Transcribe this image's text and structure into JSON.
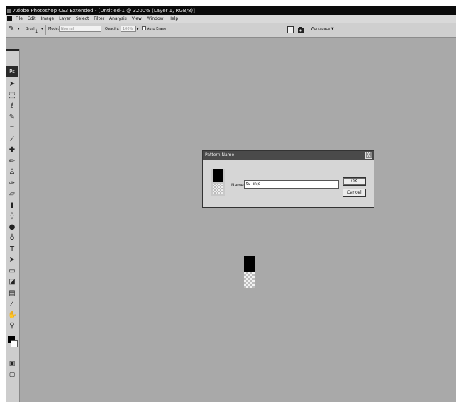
{
  "window": {
    "title": "Adobe Photoshop CS3 Extended - [Untitled-1 @ 3200% (Layer 1, RGB/8)]"
  },
  "menubar": {
    "items": [
      "File",
      "Edit",
      "Image",
      "Layer",
      "Select",
      "Filter",
      "Analysis",
      "View",
      "Window",
      "Help"
    ]
  },
  "options": {
    "brush_label": "Brush:",
    "brush_size": "1",
    "mode_label": "Mode:",
    "mode_value": "Normal",
    "opacity_label": "Opacity:",
    "opacity_value": "100%",
    "auto_erase_label": "Auto Erase",
    "workspace_label": "Workspace ▼"
  },
  "toolbox": {
    "logo": "Ps",
    "tools": [
      {
        "name": "move-tool-icon",
        "glyph": "➤"
      },
      {
        "name": "marquee-tool-icon",
        "glyph": "⬚"
      },
      {
        "name": "lasso-tool-icon",
        "glyph": "ℓ"
      },
      {
        "name": "quick-select-tool-icon",
        "glyph": "✎"
      },
      {
        "name": "crop-tool-icon",
        "glyph": "⌗"
      },
      {
        "name": "slice-tool-icon",
        "glyph": "⁄"
      },
      {
        "name": "healing-brush-tool-icon",
        "glyph": "✚"
      },
      {
        "name": "brush-tool-icon",
        "glyph": "✏"
      },
      {
        "name": "clone-stamp-tool-icon",
        "glyph": "♙"
      },
      {
        "name": "history-brush-tool-icon",
        "glyph": "✑"
      },
      {
        "name": "eraser-tool-icon",
        "glyph": "▱"
      },
      {
        "name": "gradient-tool-icon",
        "glyph": "▮"
      },
      {
        "name": "blur-tool-icon",
        "glyph": "◊"
      },
      {
        "name": "dodge-tool-icon",
        "glyph": "●"
      },
      {
        "name": "pen-tool-icon",
        "glyph": "♁"
      },
      {
        "name": "type-tool-icon",
        "glyph": "T"
      },
      {
        "name": "path-select-tool-icon",
        "glyph": "➤"
      },
      {
        "name": "shape-tool-icon",
        "glyph": "▭"
      },
      {
        "name": "3d-tool-icon",
        "glyph": "◪"
      },
      {
        "name": "notes-tool-icon",
        "glyph": "▤"
      },
      {
        "name": "eyedropper-tool-icon",
        "glyph": "⁄"
      },
      {
        "name": "hand-tool-icon",
        "glyph": "✋"
      },
      {
        "name": "zoom-tool-icon",
        "glyph": "⚲"
      }
    ]
  },
  "dialog": {
    "title": "Pattern Name",
    "close_glyph": "X",
    "name_label": "Name:",
    "name_value": "tv linje",
    "ok_label": "OK",
    "cancel_label": "Cancel"
  }
}
